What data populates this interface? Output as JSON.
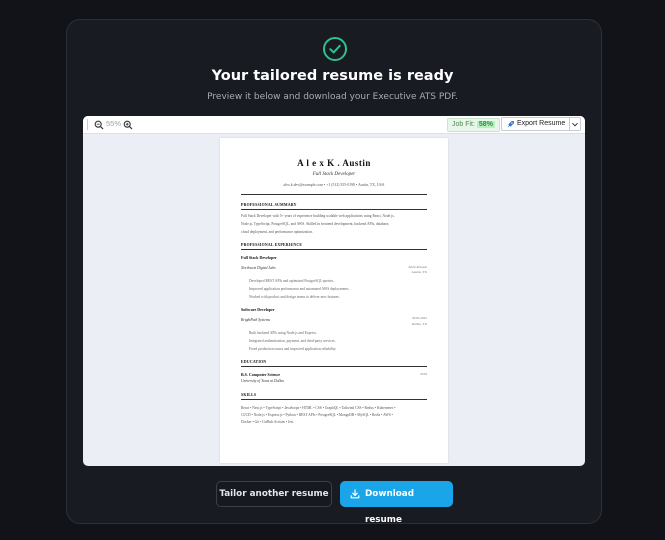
{
  "colors": {
    "accent": "#1aa5e8",
    "success": "#2fc08f",
    "background": "#111318",
    "card": "#181b22"
  },
  "header": {
    "icon": "check-circle-icon",
    "title": "Your tailored resume is ready",
    "subtitle": "Preview it below and download your Executive ATS PDF."
  },
  "toolbar": {
    "zoom_level": "55%",
    "job_fit_label": "Job Fit:",
    "job_fit_value": "58%",
    "export_label": "Export Resume"
  },
  "resume": {
    "name": "A l e x K . Austin",
    "title": "Full Stack Developer",
    "contact": "alex.k.dev@example.com • +1 (512) 555-0198 • Austin, TX, USA",
    "summary_heading": "PROFESSIONAL SUMMARY",
    "summary_line1": "Full Stack Developer with 5+ years of experience building scalable web applications using React, Node.js,",
    "summary_line2": "Node.js, TypeScript, PostgreSQL, and AWS. Skilled in frontend development, backend APIs, database,",
    "summary_line3": "cloud deployment, and performance optimization.",
    "experience_heading": "PROFESSIONAL EXPERIENCE",
    "jobs": [
      {
        "role": "Full Stack Developer",
        "company": "Northwest Digital Labs",
        "dates": "2022-Present",
        "location": "Austin, TX",
        "bullets": [
          "Developed REST APIs and optimized PostgreSQL queries.",
          "Improved application performance and automated AWS deployments.",
          "Worked with product and design teams to deliver new features."
        ]
      },
      {
        "role": "Software Developer",
        "company": "BrightPath Systems",
        "dates": "2019-2022",
        "location": "Dallas, TX",
        "bullets": [
          "Built backend APIs using Node.js and Express.",
          "Integrated authentication, payment, and third-party services.",
          "Fixed production issues and improved application reliability."
        ]
      }
    ],
    "education_heading": "EDUCATION",
    "degree": "B.S. Computer Science",
    "school": "University of Texas at Dallas",
    "grad_year": "2019",
    "skills_heading": "SKILLS",
    "skills_line1": "React • Next.js • TypeScript • JavaScript • HTML • CSS • GraphQL • Tailwind CSS • Redux • Kubernetes •",
    "skills_line2": "CI/CD • Node.js • Express.js • Python • REST APIs • PostgreSQL • MongoDB • MySQL • Redis • AWS •",
    "skills_line3": "Docker • Git • GitHub Actions • Jest"
  },
  "actions": {
    "secondary_label": "Tailor another resume",
    "primary_label": "Download resume"
  }
}
